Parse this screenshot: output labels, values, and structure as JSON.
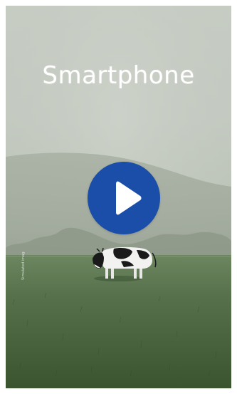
{
  "video": {
    "headline": "Smartphone",
    "watermark": "Simulated image",
    "play_button_label": "Play video",
    "colors": {
      "play_button": "#1b4ea8",
      "headline": "#ffffff",
      "sky": "#c4cac1",
      "grass": "#4f6a43"
    },
    "icons": {
      "play": "play-icon"
    }
  }
}
